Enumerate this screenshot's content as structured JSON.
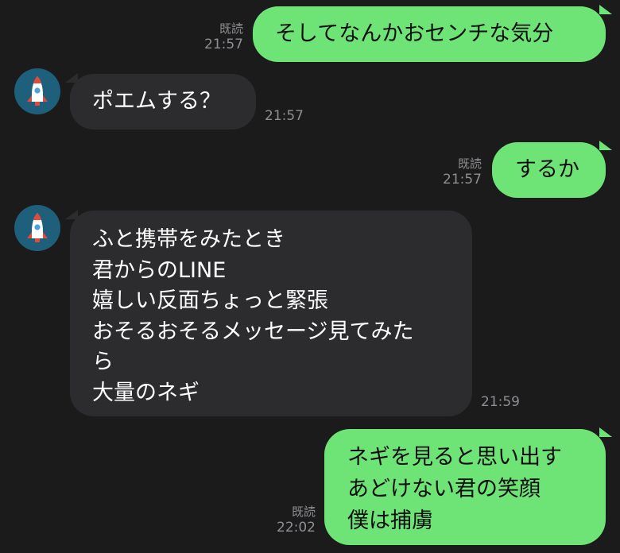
{
  "messages": [
    {
      "side": "out",
      "text": "そしてなんかおセンチな気分",
      "read": "既読",
      "time": "21:57"
    },
    {
      "side": "in",
      "text": "ポエムする？",
      "time": "21:57"
    },
    {
      "side": "out",
      "text": "するか",
      "read": "既読",
      "time": "21:57"
    },
    {
      "side": "in",
      "lines": [
        "ふと携帯をみたとき",
        "君からのLINE",
        "嬉しい反面ちょっと緊張",
        "おそるおそるメッセージ見てみた",
        "ら",
        "大量のネギ"
      ],
      "time": "21:59"
    },
    {
      "side": "out",
      "lines": [
        "ネギを見ると思い出す",
        "あどけない君の笑顔",
        "僕は捕虜"
      ],
      "read": "既読",
      "time": "22:02"
    }
  ],
  "avatar_icon": "rocket-icon",
  "colors": {
    "background": "#1b1b1b",
    "outgoing_bubble": "#6ee477",
    "incoming_bubble": "#2c2c2e",
    "avatar_bg": "#1e5f7c",
    "meta_text": "#8e8e93"
  }
}
